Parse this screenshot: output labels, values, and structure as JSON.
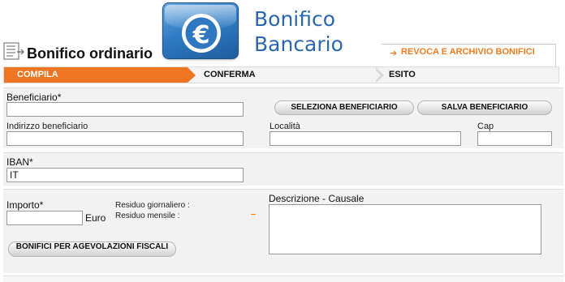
{
  "header": {
    "logo_symbol": "€",
    "logo_line1": "Bonifico",
    "logo_line2": "Bancario",
    "logo_colors": {
      "light": "#6aa9e0",
      "dark": "#1f5c9c",
      "text": "#2b67b0"
    }
  },
  "page": {
    "title": "Bonifico ordinario",
    "title_icon": "form-edit-icon",
    "revoke_link": "REVOCA E ARCHIVIO BONIFICI",
    "accent": "#ee7623"
  },
  "steps": [
    {
      "label": "COMPILA",
      "active": true
    },
    {
      "label": "CONFERMA",
      "active": false
    },
    {
      "label": "ESITO",
      "active": false
    }
  ],
  "beneficiary": {
    "label": "Beneficiario*",
    "value": "",
    "select_button": "SELEZIONA BENEFICIARIO",
    "save_button": "SALVA BENEFICIARIO",
    "address_label": "Indirizzo beneficiario",
    "address_value": "",
    "city_label": "Località",
    "city_value": "",
    "zip_label": "Cap",
    "zip_value": ""
  },
  "iban": {
    "label": "IBAN*",
    "value": "IT"
  },
  "amount": {
    "label": "Importo*",
    "value": "",
    "currency": "Euro",
    "daily_residual_label": "Residuo giornaliero :",
    "monthly_residual_label": "Residuo mensile :",
    "description_label": "Descrizione - Causale",
    "description_value": "",
    "tax_button": "BONIFICI PER AGEVOLAZIONI FISCALI"
  }
}
